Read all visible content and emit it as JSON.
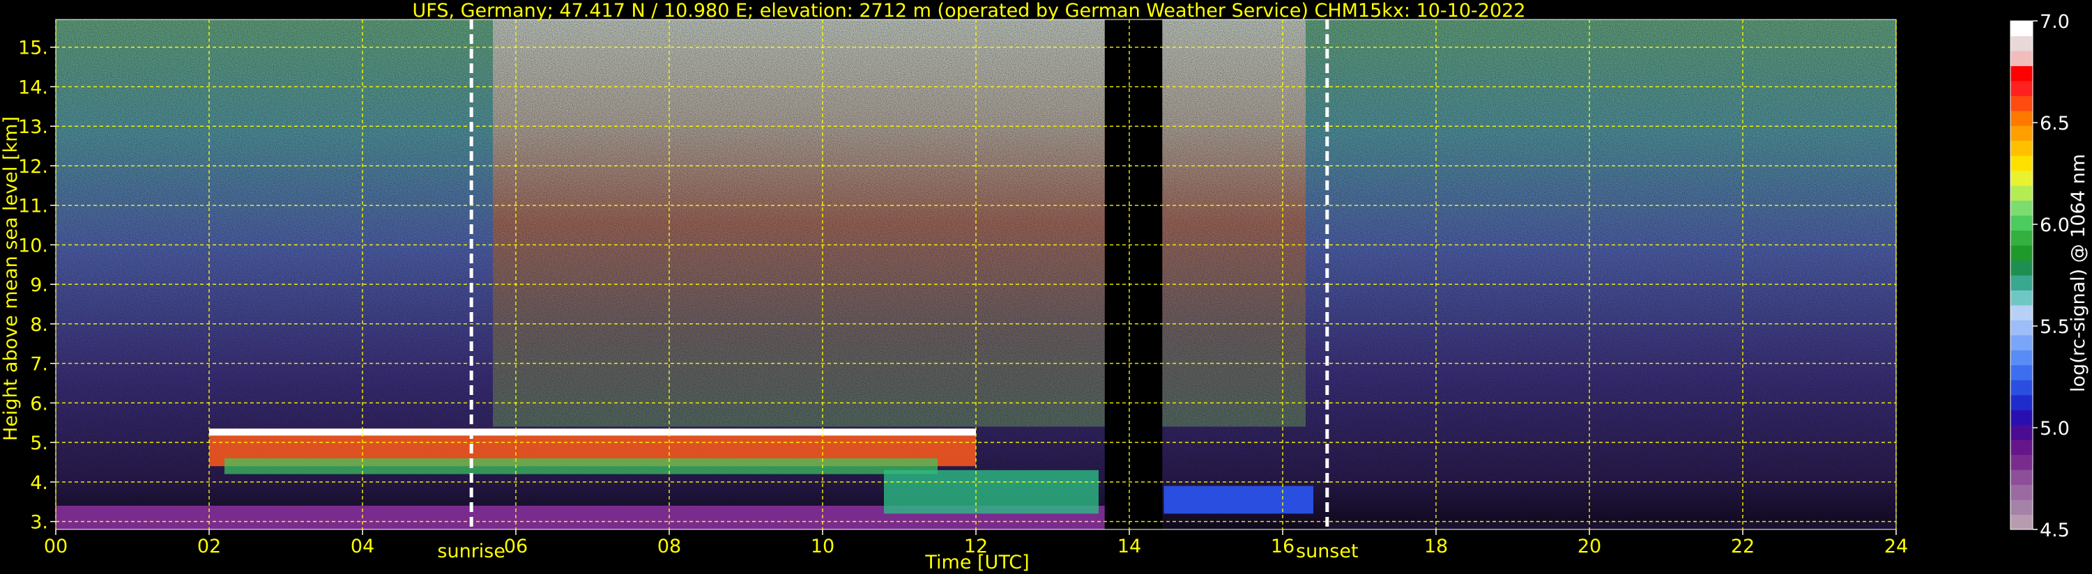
{
  "chart_data": {
    "type": "heatmap",
    "title": "UFS, Germany; 47.417 N / 10.980 E; elevation: 2712 m  (operated by German Weather Service)    CHM15kx: 10-10-2022",
    "xlabel": "Time [UTC]",
    "ylabel": "Height above mean sea level [km]",
    "xlim": [
      0,
      24
    ],
    "ylim": [
      2.8,
      15.7
    ],
    "x_ticks": [
      "00",
      "02",
      "04",
      "06",
      "08",
      "10",
      "12",
      "14",
      "16",
      "18",
      "20",
      "22",
      "24"
    ],
    "x_tick_values": [
      0,
      2,
      4,
      6,
      8,
      10,
      12,
      14,
      16,
      18,
      20,
      22,
      24
    ],
    "y_ticks": [
      "3.",
      "4.",
      "5.",
      "6.",
      "7.",
      "8.",
      "9.",
      "10.",
      "11.",
      "12.",
      "13.",
      "14.",
      "15."
    ],
    "y_tick_values": [
      3,
      4,
      5,
      6,
      7,
      8,
      9,
      10,
      11,
      12,
      13,
      14,
      15
    ],
    "grid": true,
    "markers": [
      {
        "label": "sunrise",
        "x": 5.42
      },
      {
        "label": "sunset",
        "x": 16.58
      }
    ],
    "no_data_intervals": [
      [
        13.68,
        14.43
      ]
    ],
    "colorbar": {
      "label": "log(rc-signal) @ 1064 nm",
      "range": [
        4.5,
        7.0
      ],
      "tick_labels": [
        "7.0",
        "6.5",
        "6.0",
        "5.5",
        "5.0",
        "4.5"
      ],
      "tick_values": [
        7.0,
        6.5,
        6.0,
        5.5,
        5.0,
        4.5
      ],
      "colors": [
        "#b79cb0",
        "#a582a8",
        "#9a6aa0",
        "#8c4f98",
        "#7a2c8e",
        "#66168a",
        "#4a0c93",
        "#2a0fb0",
        "#1f2ccc",
        "#2a4fe0",
        "#3d6eef",
        "#5a8cf5",
        "#7aa5f8",
        "#9cbdf8",
        "#b8d0f5",
        "#6fc7c4",
        "#38a88e",
        "#1e8f50",
        "#1f9a2a",
        "#33b03f",
        "#4ccb5f",
        "#7ddc6e",
        "#b5eb53",
        "#e8f230",
        "#ffe100",
        "#ffc000",
        "#ff9f00",
        "#ff7800",
        "#ff4a10",
        "#ff2020",
        "#ff0000",
        "#f0bcbc",
        "#e8d8d8",
        "#ffffff"
      ]
    },
    "colors": {
      "text": "#ffff00",
      "grid": "#ffff00",
      "background": "#000000"
    }
  }
}
